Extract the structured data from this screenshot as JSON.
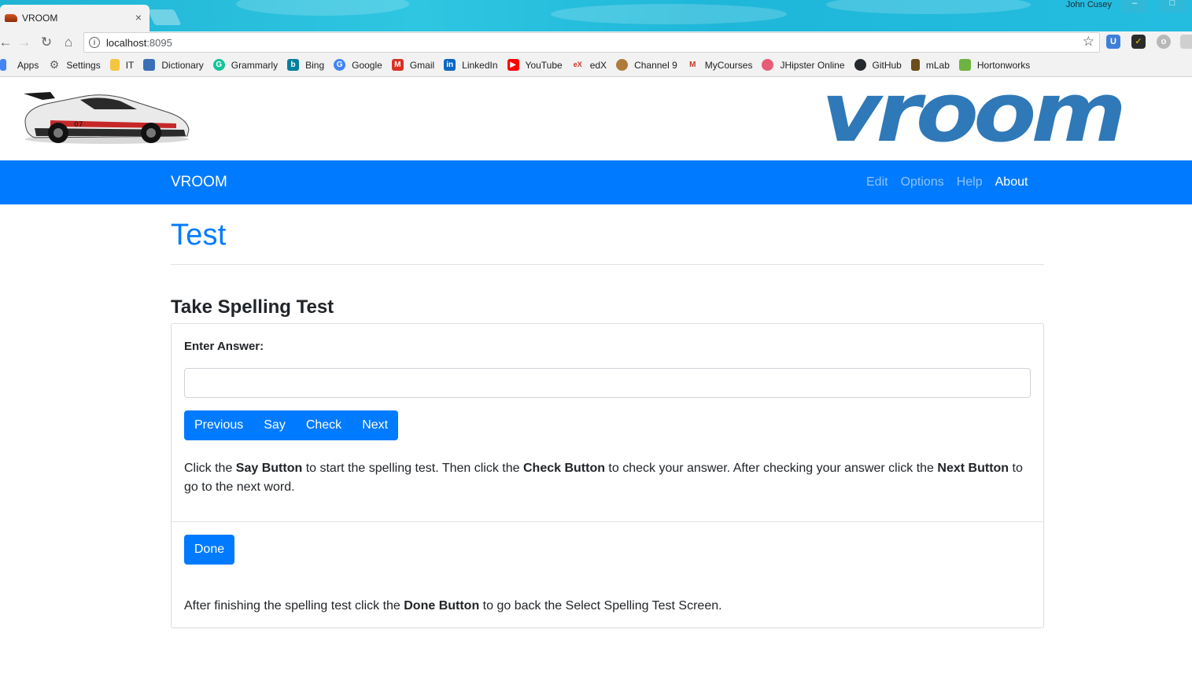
{
  "browser": {
    "tab_title": "VROOM",
    "tab_close": "×",
    "profile_name": "John Cusey",
    "url_host": "localhost",
    "url_port": ":8095",
    "bookmarks": [
      {
        "label": "Apps",
        "icon": "apps-grid-icon",
        "color": "#4285f4"
      },
      {
        "label": "Settings",
        "icon": "gear-icon",
        "color": "#5f6368"
      },
      {
        "label": "IT",
        "icon": "folder-icon",
        "color": "#f4c542"
      },
      {
        "label": "Dictionary",
        "icon": "dictionary-icon",
        "color": "#3a6fb7"
      },
      {
        "label": "Grammarly",
        "icon": "grammarly-icon",
        "color": "#15c39a"
      },
      {
        "label": "Bing",
        "icon": "bing-icon",
        "color": "#00809d"
      },
      {
        "label": "Google",
        "icon": "google-icon",
        "color": "#4285f4"
      },
      {
        "label": "Gmail",
        "icon": "gmail-icon",
        "color": "#d93025"
      },
      {
        "label": "LinkedIn",
        "icon": "linkedin-icon",
        "color": "#0a66c2"
      },
      {
        "label": "YouTube",
        "icon": "youtube-icon",
        "color": "#ff0000"
      },
      {
        "label": "edX",
        "icon": "edx-icon",
        "color": "#d23228"
      },
      {
        "label": "Channel 9",
        "icon": "channel9-icon",
        "color": "#b07a3a"
      },
      {
        "label": "MyCourses",
        "icon": "mycourses-icon",
        "color": "#c0392b"
      },
      {
        "label": "JHipster Online",
        "icon": "jhipster-icon",
        "color": "#e85d75"
      },
      {
        "label": "GitHub",
        "icon": "github-icon",
        "color": "#24292e"
      },
      {
        "label": "mLab",
        "icon": "mlab-icon",
        "color": "#6b4c1a"
      },
      {
        "label": "Hortonworks",
        "icon": "hortonworks-icon",
        "color": "#6cb33f"
      }
    ]
  },
  "navbar": {
    "brand": "VROOM",
    "links": [
      {
        "label": "Edit",
        "active": false
      },
      {
        "label": "Options",
        "active": false
      },
      {
        "label": "Help",
        "active": false
      },
      {
        "label": "About",
        "active": true
      }
    ]
  },
  "banner": {
    "logo_text": "vroom"
  },
  "main": {
    "title": "Test",
    "section_title": "Take Spelling Test",
    "answer_label": "Enter Answer:",
    "answer_value": "",
    "buttons": {
      "previous": "Previous",
      "say": "Say",
      "check": "Check",
      "next": "Next",
      "done": "Done"
    },
    "instructions": {
      "t1": "Click the ",
      "b1": "Say Button",
      "t2": " to start the spelling test. Then click the ",
      "b2": "Check Button",
      "t3": " to check your answer. After checking your answer click the ",
      "b3": "Next Button",
      "t4": " to go to the next word."
    },
    "after": {
      "t1": "After finishing the spelling test click the ",
      "b1": "Done Button",
      "t2": " to go back the Select Spelling Test Screen."
    }
  },
  "colors": {
    "primary": "#007bff",
    "logo_blue": "#2f79b8"
  }
}
